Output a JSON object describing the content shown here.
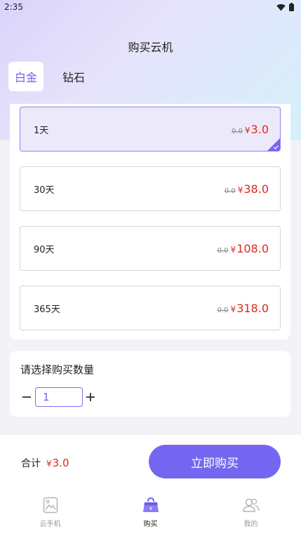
{
  "status_bar": {
    "time": "2:35"
  },
  "header": {
    "title": "购买云机"
  },
  "tabs": [
    {
      "label": "白金",
      "active": true
    },
    {
      "label": "钻石",
      "active": false
    }
  ],
  "plans": [
    {
      "name": "1天",
      "original": "0.0",
      "currency": "¥",
      "price": "3.0",
      "selected": true
    },
    {
      "name": "30天",
      "original": "0.0",
      "currency": "¥",
      "price": "38.0",
      "selected": false
    },
    {
      "name": "90天",
      "original": "0.0",
      "currency": "¥",
      "price": "108.0",
      "selected": false
    },
    {
      "name": "365天",
      "original": "0.0",
      "currency": "¥",
      "price": "318.0",
      "selected": false
    }
  ],
  "quantity": {
    "title": "请选择购买数量",
    "value": "1"
  },
  "footer": {
    "total_label": "合计",
    "currency": "¥",
    "total": "3.0",
    "buy_label": "立即购买"
  },
  "nav": [
    {
      "label": "云手机",
      "icon": "phone-image-icon",
      "active": false
    },
    {
      "label": "购买",
      "icon": "shopping-bag-icon",
      "active": true
    },
    {
      "label": "我的",
      "icon": "users-icon",
      "active": false
    }
  ],
  "colors": {
    "accent": "#7566f1",
    "price": "#e1261c",
    "selected_bg": "#ece9fb"
  }
}
